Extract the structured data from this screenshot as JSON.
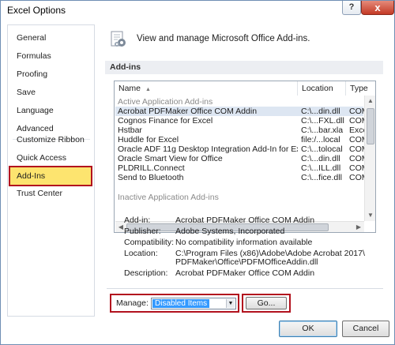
{
  "window": {
    "title": "Excel Options",
    "help": "?",
    "close": "x"
  },
  "sidebar": {
    "items": [
      {
        "label": "General"
      },
      {
        "label": "Formulas"
      },
      {
        "label": "Proofing"
      },
      {
        "label": "Save"
      },
      {
        "label": "Language"
      },
      {
        "label": "Advanced"
      },
      {
        "label": "Customize Ribbon"
      },
      {
        "label": "Quick Access Toolbar"
      },
      {
        "label": "Add-Ins"
      },
      {
        "label": "Trust Center"
      }
    ],
    "selected": "Add-Ins"
  },
  "header": {
    "text": "View and manage Microsoft Office Add-ins.",
    "icon": "addins-gear-icon"
  },
  "section": {
    "title": "Add-ins"
  },
  "table": {
    "columns": [
      "Name",
      "Location",
      "Type"
    ],
    "active_group": "Active Application Add-ins",
    "rows": [
      {
        "name": "Acrobat PDFMaker Office COM Addin",
        "location": "C:\\...din.dll",
        "type": "COM"
      },
      {
        "name": "Cognos Finance for Excel",
        "location": "C:\\...FXL.dll",
        "type": "COM"
      },
      {
        "name": "Hstbar",
        "location": "C:\\...bar.xla",
        "type": "Excel"
      },
      {
        "name": "Huddle for Excel",
        "location": "file:/...local",
        "type": "COM"
      },
      {
        "name": "Oracle ADF 11g Desktop Integration Add-In for Excel",
        "location": "C:\\...tolocal",
        "type": "COM"
      },
      {
        "name": "Oracle Smart View for Office",
        "location": "C:\\...din.dll",
        "type": "COM"
      },
      {
        "name": "PLDRILL.Connect",
        "location": "C:\\...ILL.dll",
        "type": "COM"
      },
      {
        "name": "Send to Bluetooth",
        "location": "C:\\...fice.dll",
        "type": "COM"
      }
    ],
    "inactive_group": "Inactive Application Add-ins"
  },
  "details": {
    "addin_label": "Add-in:",
    "addin": "Acrobat PDFMaker Office COM Addin",
    "publisher_label": "Publisher:",
    "publisher": "Adobe Systems, Incorporated",
    "compat_label": "Compatibility:",
    "compat": "No compatibility information available",
    "location_label": "Location:",
    "location_line1": "C:\\Program Files (x86)\\Adobe\\Adobe Acrobat 2017\\",
    "location_line2": "PDFMaker\\Office\\PDFMOfficeAddin.dll",
    "description_label": "Description:",
    "description": "Acrobat PDFMaker Office COM Addin"
  },
  "manage": {
    "label": "Manage:",
    "value": "Disabled Items",
    "go_label": "Go..."
  },
  "footer": {
    "ok": "OK",
    "cancel": "Cancel"
  },
  "colors": {
    "highlight": "#fde46f",
    "annotation": "#b2121e",
    "selection": "#3399ff"
  }
}
